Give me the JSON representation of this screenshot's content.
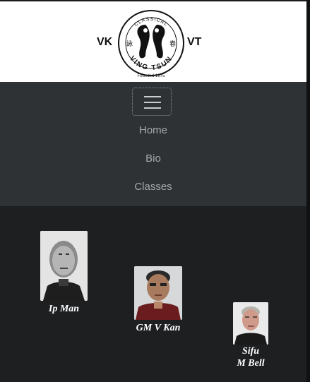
{
  "header": {
    "brand_left": "VK",
    "brand_right": "VT",
    "logo": {
      "arc_top": "CLASSICAL",
      "arc_bottom": "VING TSUN",
      "char_left": "詠",
      "char_right": "春",
      "founded": "Founded 1975"
    }
  },
  "nav": {
    "toggler_icon": "hamburger-icon",
    "items": [
      {
        "label": "Home"
      },
      {
        "label": "Bio"
      },
      {
        "label": "Classes"
      }
    ]
  },
  "lineage": [
    {
      "name": "Ip Man"
    },
    {
      "name": "GM V Kan"
    },
    {
      "name_line1": "Sifu",
      "name_line2": "M Bell"
    }
  ]
}
